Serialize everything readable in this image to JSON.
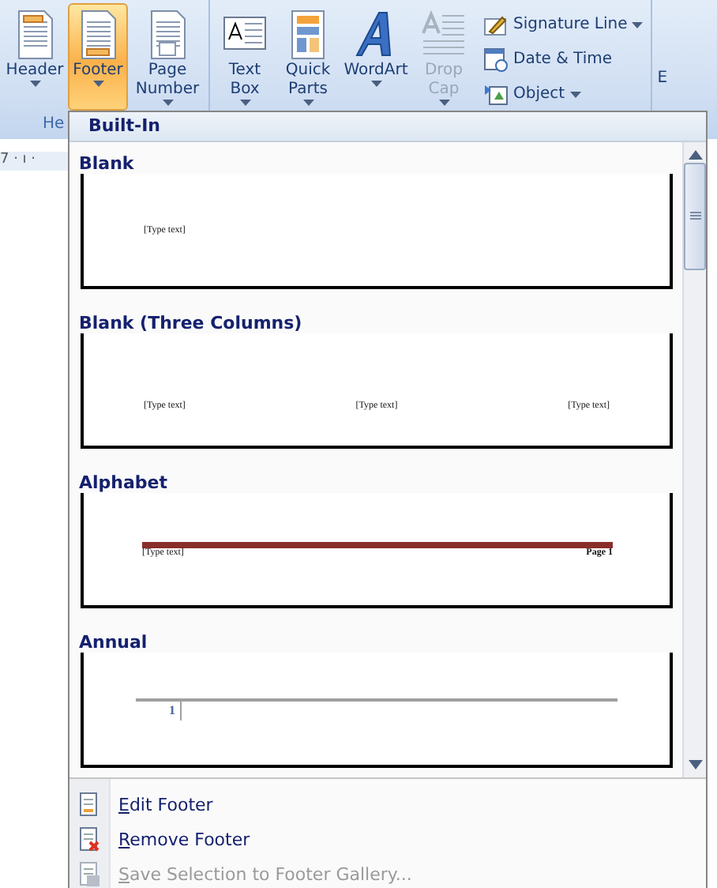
{
  "ribbon": {
    "groups": [
      {
        "label": "He",
        "buttons": [
          {
            "label": "Header",
            "dropdown": true,
            "selected": false,
            "disabled": false
          },
          {
            "label": "Footer",
            "dropdown": true,
            "selected": true,
            "disabled": false
          },
          {
            "label": "Page Number",
            "dropdown": true,
            "selected": false,
            "disabled": false
          }
        ]
      },
      {
        "buttons": [
          {
            "label": "Text Box",
            "dropdown": true,
            "selected": false,
            "disabled": false
          },
          {
            "label": "Quick Parts",
            "dropdown": true,
            "selected": false,
            "disabled": false
          },
          {
            "label": "WordArt",
            "dropdown": true,
            "selected": false,
            "disabled": false
          },
          {
            "label": "Drop Cap",
            "dropdown": true,
            "selected": false,
            "disabled": true
          }
        ],
        "small_buttons": [
          {
            "label": "Signature Line",
            "dropdown": true
          },
          {
            "label": "Date & Time",
            "dropdown": false
          },
          {
            "label": "Object",
            "dropdown": true
          }
        ]
      }
    ],
    "cut_label": "E"
  },
  "ruler": "7 · ı ·",
  "gallery": {
    "heading": "Built-In",
    "items": [
      {
        "title": "Blank",
        "kind": "blank",
        "texts": [
          "[Type text]"
        ]
      },
      {
        "title": "Blank (Three Columns)",
        "kind": "three_columns",
        "texts": [
          "[Type text]",
          "[Type text]",
          "[Type text]"
        ]
      },
      {
        "title": "Alphabet",
        "kind": "alphabet",
        "texts": [
          "[Type text]",
          "Page 1"
        ]
      },
      {
        "title": "Annual",
        "kind": "annual",
        "texts": [
          "1"
        ]
      }
    ]
  },
  "menu": [
    {
      "label": "Edit Footer",
      "disabled": false
    },
    {
      "label": "Remove Footer",
      "disabled": false
    },
    {
      "label": "Save Selection to Footer Gallery...",
      "disabled": true
    }
  ]
}
